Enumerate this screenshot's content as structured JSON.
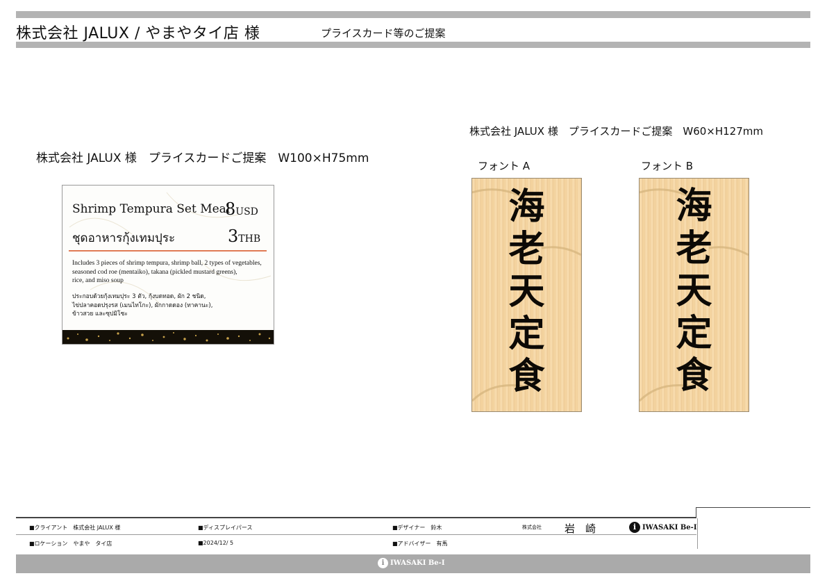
{
  "header": {
    "title": "株式会社 JALUX / やまやタイ店 様",
    "subtitle": "プライスカード等のご提案"
  },
  "left_section": {
    "title": "株式会社 JALUX 様　プライスカードご提案　W100×H75mm",
    "card": {
      "name_en": "Shrimp Tempura Set Meal",
      "price_usd": "8",
      "currency_usd": "USD",
      "name_th": "ชุดอาหารกุ้งเทมปุระ",
      "price_thb": "3",
      "currency_thb": "THB",
      "desc_en_1": "Includes 3 pieces of shrimp tempura, shrimp ball, 2 types of vegetables,",
      "desc_en_2": "seasoned cod roe (mentaiko), takana (pickled mustard greens),",
      "desc_en_3": "rice, and miso soup",
      "desc_th_1": "ประกอบด้วยกุ้งเทมปุระ 3 ตัว, กุ้งบดทอด, ผัก 2 ชนิด,",
      "desc_th_2": "ไข่ปลาคอดปรุงรส (เมนไทโกะ), ผักกาดดอง (ทาคานะ),",
      "desc_th_3": "ข้าวสวย และซุปมิโซะ"
    }
  },
  "right_section": {
    "title": "株式会社 JALUX 様　プライスカードご提案　W60×H127mm",
    "font_a_label": "フォント A",
    "font_b_label": "フォント B",
    "vertical_chars": [
      "海",
      "老",
      "天",
      "定",
      "食"
    ]
  },
  "footer": {
    "client": "■クライアント　株式会社 JALUX 様",
    "location": "■ロケーション　やまや　タイ店",
    "type": "■ディスプレイパース",
    "date": "■2024/12/ 5",
    "designer": "■デザイナー　鈴木",
    "advisor": "■アドバイザー　有馬",
    "company_prefix": "株式会社",
    "company_name": "岩　崎",
    "logo_text": "IWASAKI Be-I",
    "bottom_logo_text": "IWASAKI Be-I"
  },
  "colors": {
    "bar": "#b3b3b3",
    "red_line": "#e07a55",
    "wood": "#f5d8a8",
    "gold": "#c8a24a"
  }
}
